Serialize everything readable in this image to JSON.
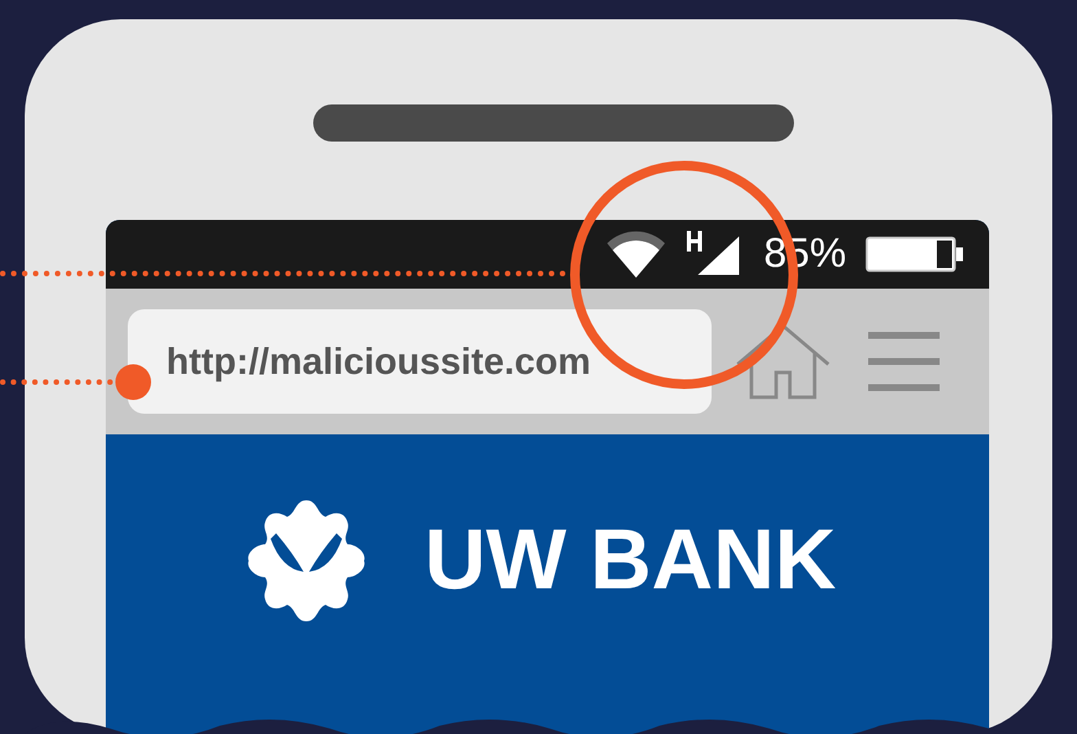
{
  "status_bar": {
    "battery_text": "85%"
  },
  "browser": {
    "url": "http://malicioussite.com"
  },
  "site": {
    "brand": "UW BANK"
  }
}
